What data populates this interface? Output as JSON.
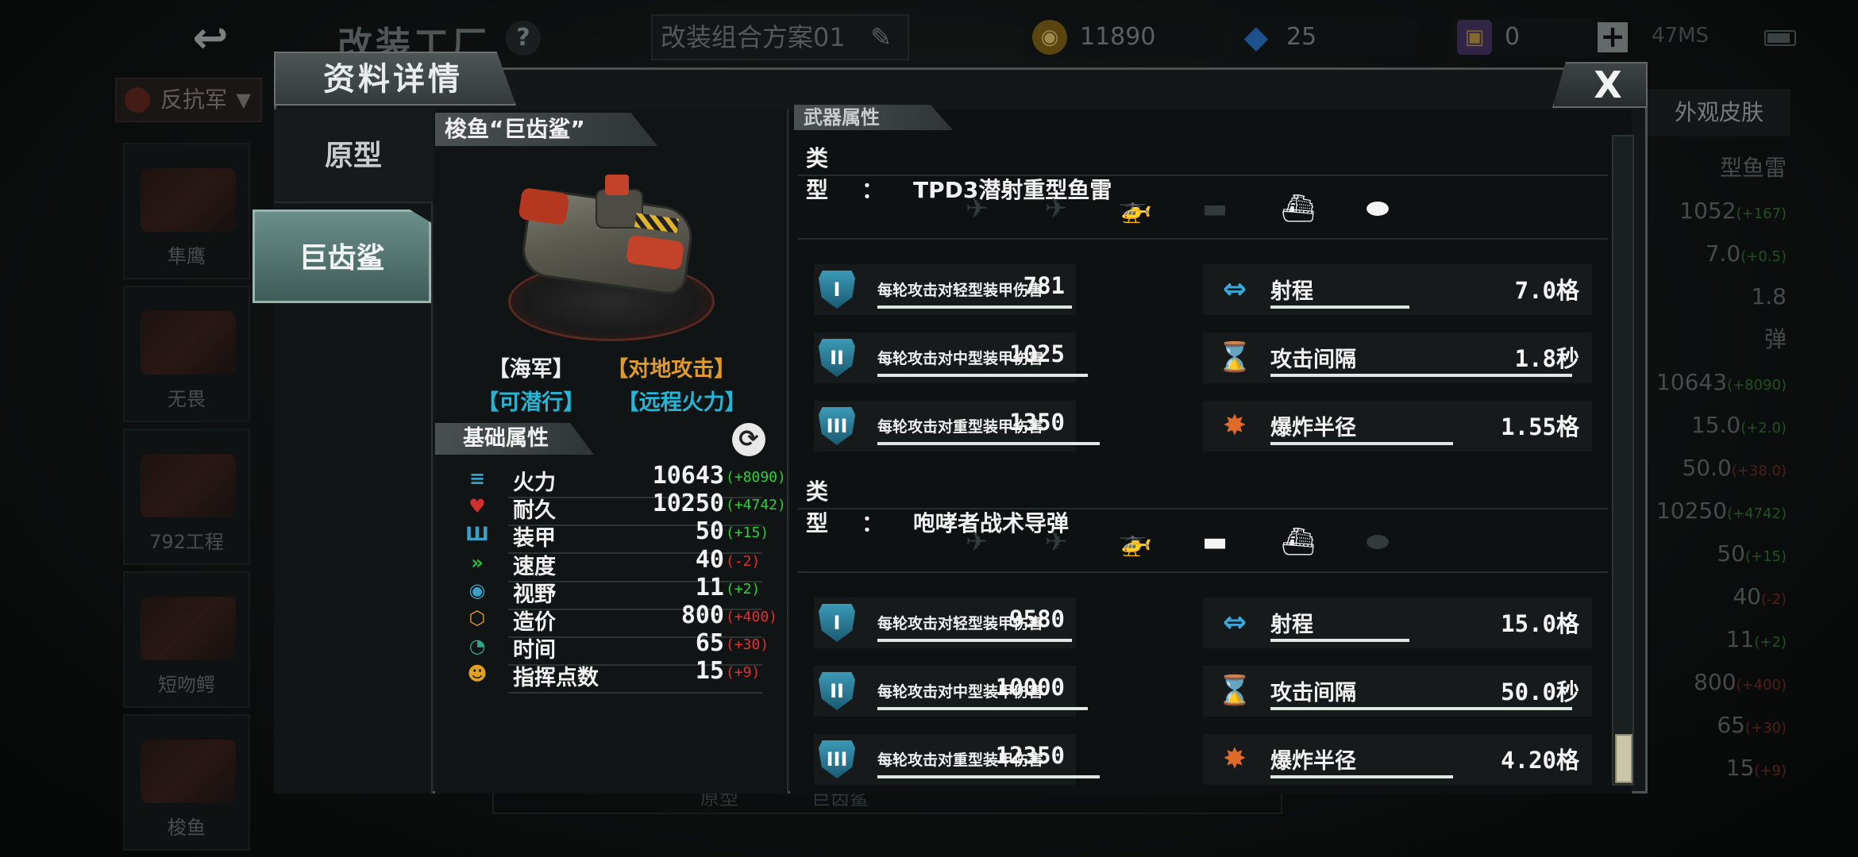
{
  "background": {
    "back_glyph": "↩",
    "title": "改装工厂",
    "help": "?",
    "plan_name": "改装组合方案01",
    "pencil": "✎",
    "resources": {
      "gold_icon": "◉",
      "gold": "11890",
      "gem_icon": "◆",
      "gem": "25",
      "card_icon": "▣",
      "card": "0"
    },
    "add": "+",
    "ping": "47MS",
    "faction": "反抗军",
    "faction_caret": "▼",
    "units": [
      "隼鹰",
      "无畏",
      "792工程",
      "短吻鳄",
      "梭鱼"
    ],
    "right_tab": "外观皮肤",
    "right_stats": [
      {
        "text": "型鱼雷",
        "delta": "",
        "kind": "g"
      },
      {
        "text": "1052",
        "delta": "(+167)",
        "kind": "g"
      },
      {
        "text": "7.0",
        "delta": "(+0.5)",
        "kind": "g"
      },
      {
        "text": "1.8",
        "delta": "",
        "kind": "g"
      },
      {
        "text": "弹",
        "delta": "",
        "kind": "g"
      },
      {
        "text": "10643",
        "delta": "(+8090)",
        "kind": "g"
      },
      {
        "text": "15.0",
        "delta": "(+2.0)",
        "kind": "g"
      },
      {
        "text": "50.0",
        "delta": "(+38.0)",
        "kind": "r"
      },
      {
        "text": "10250",
        "delta": "(+4742)",
        "kind": "g"
      },
      {
        "text": "50",
        "delta": "(+15)",
        "kind": "g"
      },
      {
        "text": "40",
        "delta": "(-2)",
        "kind": "r"
      },
      {
        "text": "11",
        "delta": "(+2)",
        "kind": "g"
      },
      {
        "text": "800",
        "delta": "(+400)",
        "kind": "r"
      },
      {
        "text": "65",
        "delta": "(+30)",
        "kind": "r"
      },
      {
        "text": "15",
        "delta": "(+9)",
        "kind": "r"
      }
    ],
    "under_tabs": [
      "原型",
      "巨齿鲨"
    ]
  },
  "modal": {
    "title": "资料详情",
    "close": "X",
    "side_tabs": [
      "原型",
      "巨齿鲨"
    ],
    "unit_name": "梭鱼“巨齿鲨”",
    "tags_line1": [
      "【海军】",
      "【对地攻击】"
    ],
    "tags_line2": [
      "【可潜行】",
      "【远程火力】"
    ],
    "basic_title": "基础属性",
    "refresh_icon": "⟳",
    "stats": [
      {
        "icon": "≡",
        "icon_name": "firepower-icon",
        "color": "#3aa0c8",
        "label": "火力",
        "value": "10643",
        "delta": "(+8090)",
        "sign": "pos"
      },
      {
        "icon": "♥",
        "icon_name": "heart-icon",
        "color": "#d03030",
        "label": "耐久",
        "value": "10250",
        "delta": "(+4742)",
        "sign": "pos"
      },
      {
        "icon": "Ш",
        "icon_name": "armor-icon",
        "color": "#3aa0c8",
        "label": "装甲",
        "value": "50",
        "delta": "(+15)",
        "sign": "pos"
      },
      {
        "icon": "»",
        "icon_name": "speed-icon",
        "color": "#2cbf3a",
        "label": "速度",
        "value": "40",
        "delta": "(-2)",
        "sign": "neg"
      },
      {
        "icon": "◉",
        "icon_name": "eye-icon",
        "color": "#3aa0c8",
        "label": "视野",
        "value": "11",
        "delta": "(+2)",
        "sign": "pos"
      },
      {
        "icon": "⬡",
        "icon_name": "cube-icon",
        "color": "#e0a020",
        "label": "造价",
        "value": "800",
        "delta": "(+400)",
        "sign": "neg"
      },
      {
        "icon": "◔",
        "icon_name": "clock-icon",
        "color": "#2aa888",
        "label": "时间",
        "value": "65",
        "delta": "(+30)",
        "sign": "neg"
      },
      {
        "icon": "☻",
        "icon_name": "command-icon",
        "color": "#e0a020",
        "label": "指挥点数",
        "value": "15",
        "delta": "(+9)",
        "sign": "neg"
      }
    ],
    "weapon_title": "武器属性",
    "type_label": "类型：",
    "targets_glyphs": [
      "✈",
      "✈",
      "🚁",
      "▬",
      "⛴",
      "⬬"
    ],
    "weapons": [
      {
        "name": "TPD3潜射重型鱼雷",
        "targets_on": [
          false,
          false,
          false,
          false,
          true,
          true
        ],
        "damage": [
          {
            "tier": "I",
            "label": "每轮攻击对轻型装甲伤害",
            "value": "781"
          },
          {
            "tier": "II",
            "label": "每轮攻击对中型装甲伤害",
            "value": "1025"
          },
          {
            "tier": "III",
            "label": "每轮攻击对重型装甲伤害",
            "value": "1350"
          }
        ],
        "props": [
          {
            "icon": "⇔",
            "cls": "ic-range",
            "label": "射程",
            "value": "7.0格"
          },
          {
            "icon": "⌛",
            "cls": "ic-hour",
            "label": "攻击间隔",
            "value": "1.8秒"
          },
          {
            "icon": "✸",
            "cls": "ic-blast",
            "label": "爆炸半径",
            "value": "1.55格"
          }
        ]
      },
      {
        "name": "咆哮者战术导弹",
        "targets_on": [
          false,
          false,
          false,
          true,
          true,
          false
        ],
        "damage": [
          {
            "tier": "I",
            "label": "每轮攻击对轻型装甲伤害",
            "value": "9580"
          },
          {
            "tier": "II",
            "label": "每轮攻击对中型装甲伤害",
            "value": "10000"
          },
          {
            "tier": "III",
            "label": "每轮攻击对重型装甲伤害",
            "value": "12350"
          }
        ],
        "props": [
          {
            "icon": "⇔",
            "cls": "ic-range",
            "label": "射程",
            "value": "15.0格"
          },
          {
            "icon": "⌛",
            "cls": "ic-hour",
            "label": "攻击间隔",
            "value": "50.0秒"
          },
          {
            "icon": "✸",
            "cls": "ic-blast",
            "label": "爆炸半径",
            "value": "4.20格"
          }
        ]
      }
    ]
  }
}
